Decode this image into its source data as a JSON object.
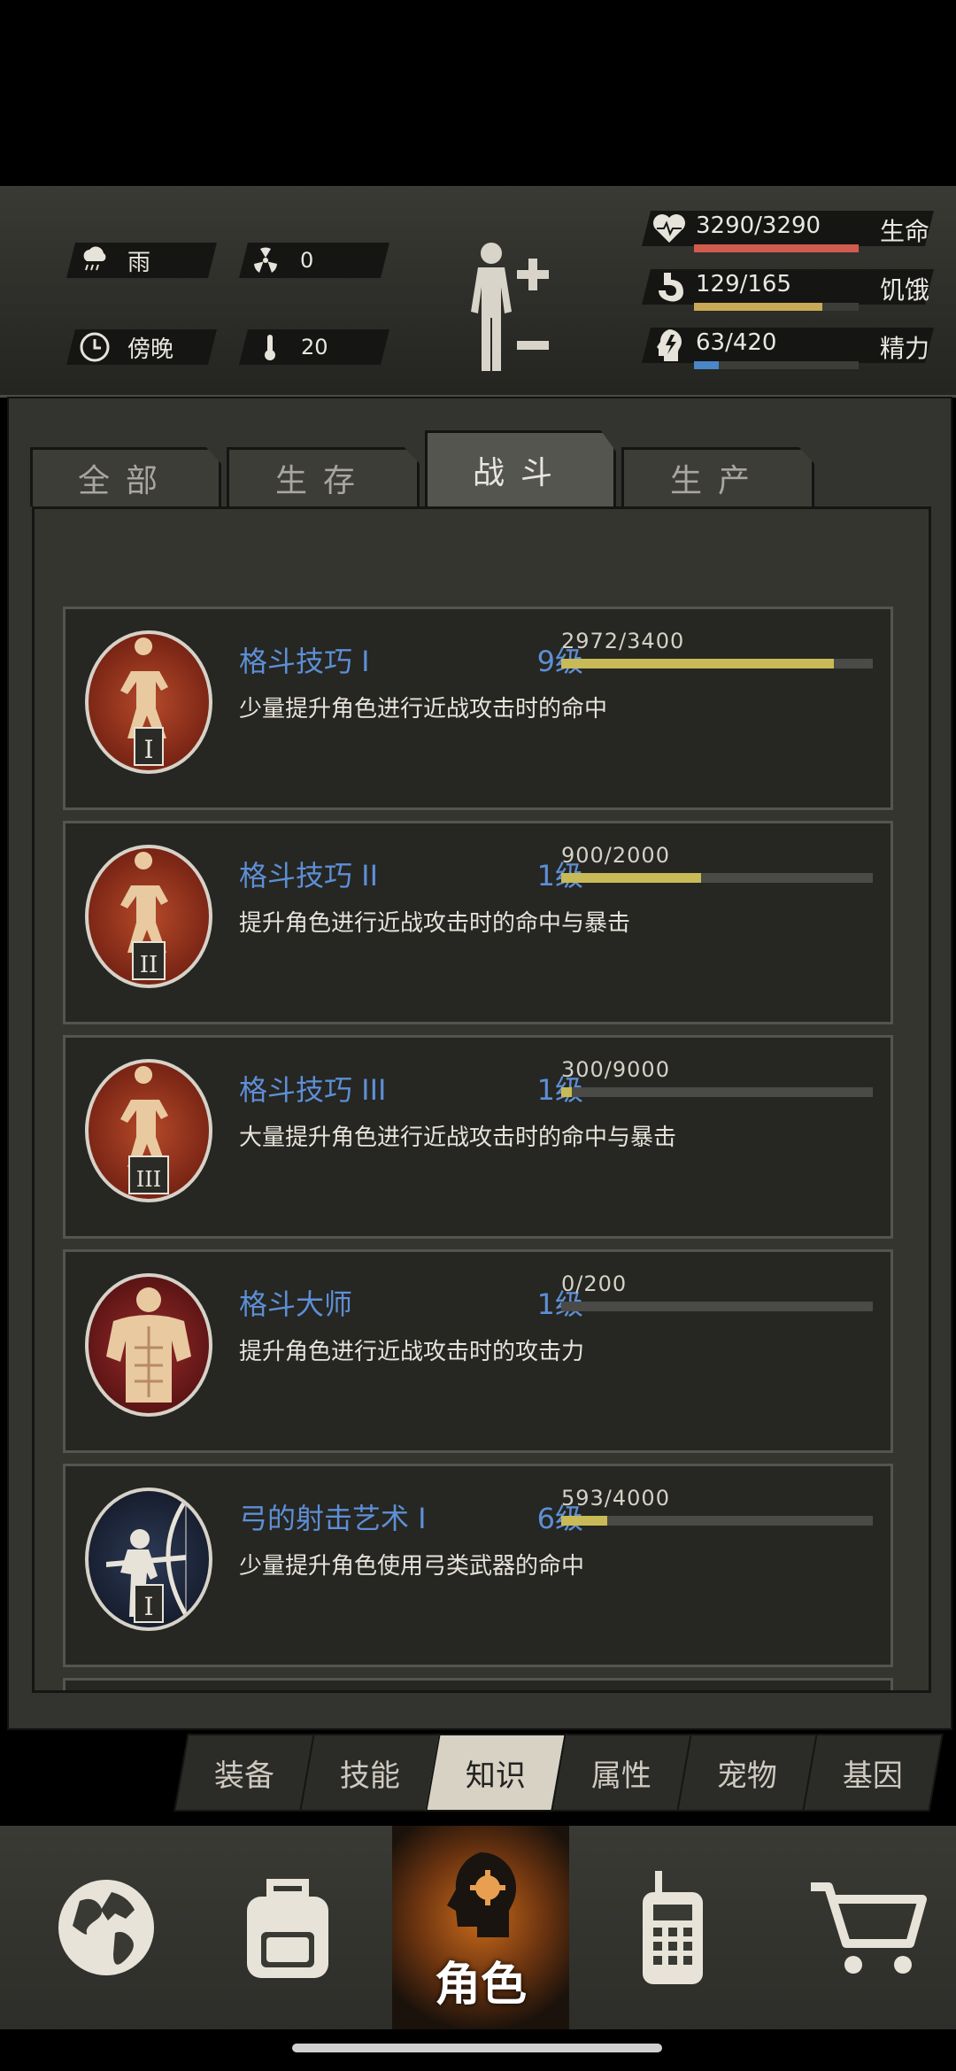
{
  "status": {
    "weather": "雨",
    "radiation": "0",
    "time_of_day": "傍晚",
    "temperature": "20",
    "health": {
      "value": "3290/3290",
      "label": "生命",
      "fill": 1.0,
      "color": "#d25b4f"
    },
    "hunger": {
      "value": "129/165",
      "label": "饥饿",
      "fill": 0.78,
      "color": "#c9a957"
    },
    "energy": {
      "value": "63/420",
      "label": "精力",
      "fill": 0.15,
      "color": "#4b86c8"
    }
  },
  "tabs": [
    {
      "label": "全部"
    },
    {
      "label": "生存"
    },
    {
      "label": "战斗"
    },
    {
      "label": "生产"
    }
  ],
  "active_tab": "战斗",
  "skills": [
    {
      "name": "格斗技巧 I",
      "level": "9级",
      "progress": "2972/3400",
      "fill": 0.874,
      "desc": "少量提升角色进行近战攻击时的命中",
      "numeral": "I",
      "icon": "fighter-icon"
    },
    {
      "name": "格斗技巧 II",
      "level": "1级",
      "progress": "900/2000",
      "fill": 0.45,
      "desc": "提升角色进行近战攻击时的命中与暴击",
      "numeral": "II",
      "icon": "fighter-icon"
    },
    {
      "name": "格斗技巧 III",
      "level": "1级",
      "progress": "300/9000",
      "fill": 0.033,
      "desc": "大量提升角色进行近战攻击时的命中与暴击",
      "numeral": "III",
      "icon": "fighter-icon"
    },
    {
      "name": "格斗大师",
      "level": "1级",
      "progress": "0/200",
      "fill": 0.0,
      "desc": "提升角色进行近战攻击时的攻击力",
      "numeral": "",
      "icon": "muscle-icon"
    },
    {
      "name": "弓的射击艺术 I",
      "level": "6级",
      "progress": "593/4000",
      "fill": 0.148,
      "desc": "少量提升角色使用弓类武器的命中",
      "numeral": "I",
      "icon": "archer-icon"
    }
  ],
  "subnav": [
    {
      "label": "装备"
    },
    {
      "label": "技能"
    },
    {
      "label": "知识"
    },
    {
      "label": "属性"
    },
    {
      "label": "宠物"
    },
    {
      "label": "基因"
    }
  ],
  "active_subnav": "知识",
  "bottomnav": {
    "active_label": "角色",
    "items": [
      "globe-icon",
      "backpack-icon",
      "character-icon",
      "radio-icon",
      "cart-icon"
    ]
  }
}
